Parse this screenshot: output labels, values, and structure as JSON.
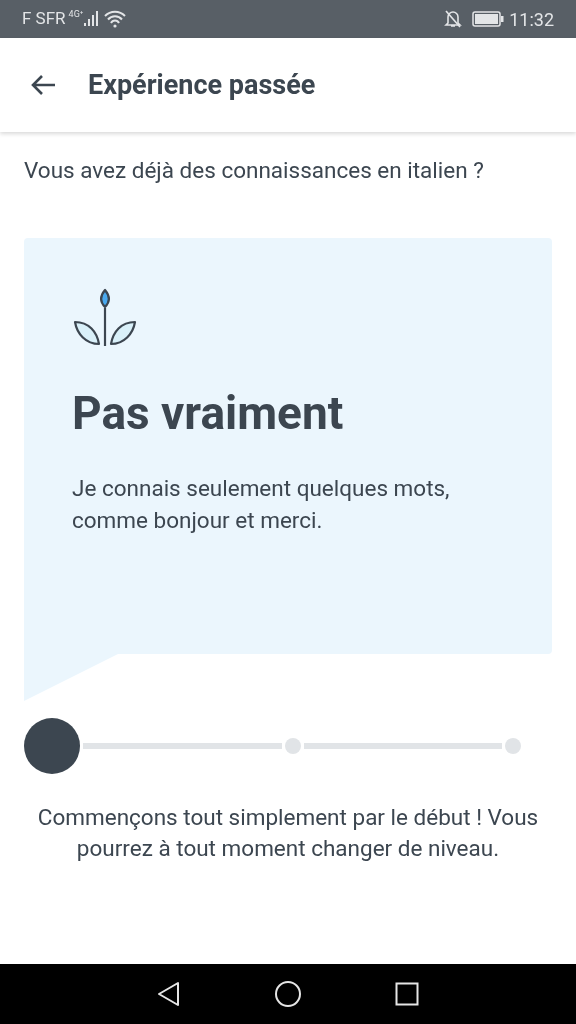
{
  "status_bar": {
    "carrier": "F SFR",
    "network": "4G⁺",
    "time": "11:32"
  },
  "app_bar": {
    "title": "Expérience passée"
  },
  "question": "Vous avez déjà des connaissances en italien ?",
  "card": {
    "title": "Pas vraiment",
    "description": "Je connais seulement quelques mots, comme bonjour et merci."
  },
  "level_steps": [
    {
      "selected": true
    },
    {
      "selected": false
    },
    {
      "selected": false
    }
  ],
  "footer_text": "Commençons tout simplement par le début ! Vous pourrez à tout moment changer de niveau."
}
